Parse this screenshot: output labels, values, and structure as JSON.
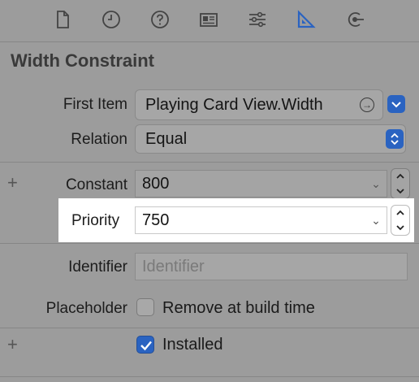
{
  "toolbar": {
    "icons": [
      "file-inspector-icon",
      "history-inspector-icon",
      "quick-help-icon",
      "identity-inspector-icon",
      "attributes-inspector-icon",
      "size-inspector-icon",
      "connections-inspector-icon"
    ],
    "selected": "size-inspector-icon",
    "accent_color": "#2a63c1"
  },
  "section": {
    "title": "Width Constraint"
  },
  "first_item": {
    "label": "First Item",
    "value": "Playing Card View.Width"
  },
  "relation": {
    "label": "Relation",
    "value": "Equal"
  },
  "constant": {
    "label": "Constant",
    "value": "800",
    "add_symbol": "+"
  },
  "priority": {
    "label": "Priority",
    "value": "750"
  },
  "identifier": {
    "label": "Identifier",
    "placeholder": "Identifier"
  },
  "placeholder": {
    "label": "Placeholder",
    "checkbox_label": "Remove at build time",
    "checked": false
  },
  "installed": {
    "checkbox_label": "Installed",
    "checked": true,
    "add_symbol": "+"
  }
}
